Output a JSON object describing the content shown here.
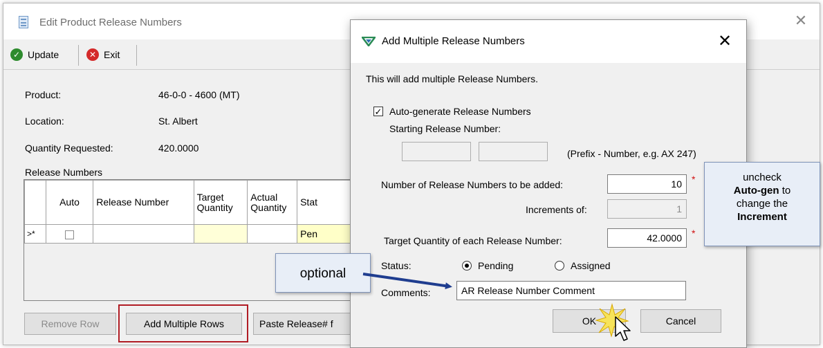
{
  "main": {
    "title": "Edit Product Release Numbers",
    "toolbar": {
      "update_label": "Update",
      "exit_label": "Exit"
    },
    "fields": [
      {
        "label": "Product:",
        "value": "46-0-0 - 4600 (MT)"
      },
      {
        "label": "Location:",
        "value": "St. Albert"
      },
      {
        "label": "Quantity Requested:",
        "value": "420.0000"
      }
    ],
    "release_numbers_label": "Release Numbers",
    "grid": {
      "headers": [
        "Auto",
        "Release Number",
        "Target Quantity",
        "Actual Quantity",
        "Stat"
      ],
      "row": {
        "indicator": ">*",
        "status": "Pen"
      }
    },
    "buttons": {
      "remove_row": "Remove Row",
      "add_multiple_rows": "Add Multiple Rows",
      "paste": "Paste Release# f"
    }
  },
  "dialog": {
    "title": "Add Multiple Release Numbers",
    "intro": "This will add multiple Release Numbers.",
    "auto_generate_label": "Auto-generate Release Numbers",
    "auto_generate_checked": true,
    "starting_label": "Starting Release Number:",
    "prefix_hint": "(Prefix - Number, e.g. AX 247)",
    "count_label": "Number of Release Numbers to be added:",
    "count_value": "10",
    "increments_label": "Increments of:",
    "increments_value": "1",
    "target_label": "Target Quantity of each Release Number:",
    "target_value": "42.0000",
    "required_mark": "*",
    "status_label": "Status:",
    "status_options": [
      "Pending",
      "Assigned"
    ],
    "status_selected": "Pending",
    "comments_label": "Comments:",
    "comments_value": "AR Release Number Comment",
    "ok_label": "OK",
    "cancel_label": "Cancel"
  },
  "callouts": {
    "optional": "optional",
    "autogen": {
      "line1": "uncheck",
      "line2": "Auto-gen",
      "line3": " to",
      "line4": "change the",
      "line5": "Increment"
    }
  },
  "colors": {
    "highlight_border": "#b01c24",
    "arrow": "#1f3d8f",
    "target_cell": "#ffffd8",
    "status_cell": "#ffffc8"
  }
}
